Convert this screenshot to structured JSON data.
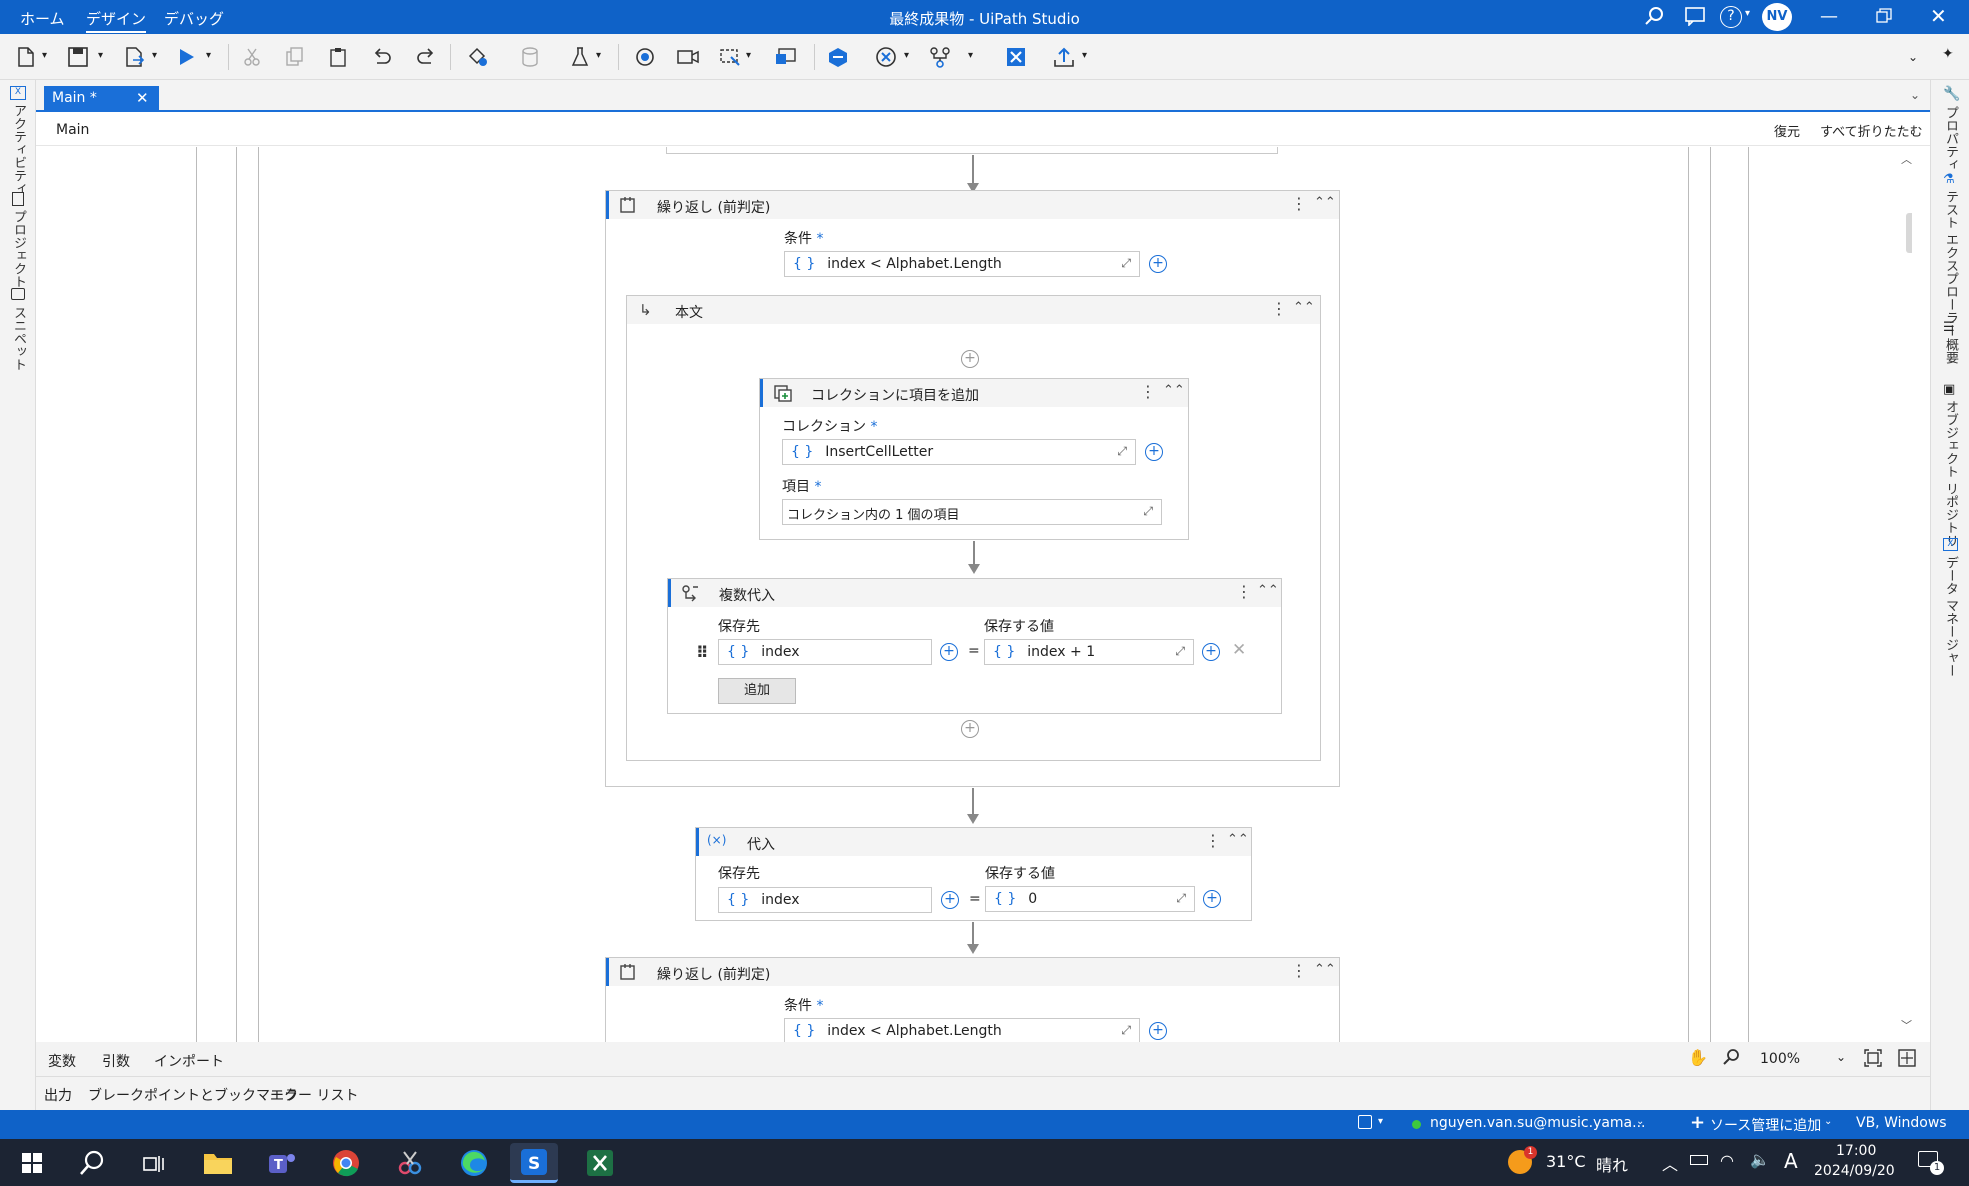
{
  "titlebar": {
    "menu_home": "ホーム",
    "menu_design": "デザイン",
    "menu_debug": "デバッグ",
    "window_title": "最終成果物 - UiPath Studio",
    "avatar_initials": "NV",
    "help_label": "?"
  },
  "tabs": {
    "main": "Main *"
  },
  "breadcrumb": {
    "path": "Main",
    "restore": "復元",
    "collapse_all": "すべて折りたたむ"
  },
  "left_panel": {
    "activities": "アクティビティ",
    "project": "プロジェクト",
    "snippets": "スニペット"
  },
  "right_panel": {
    "properties": "プロパティ",
    "test_explorer": "テスト エクスプローラー",
    "outline": "概要",
    "object_repository": "オブジェクト リポジトリ",
    "data_manager": "データ マネージャー"
  },
  "workflow": {
    "while1": {
      "title": "繰り返し (前判定)",
      "condition_label": "条件",
      "condition_value": "index < Alphabet.Length",
      "body": {
        "title": "本文",
        "add_to_collection": {
          "title": "コレクションに項目を追加",
          "collection_label": "コレクション",
          "collection_value": "InsertCellLetter",
          "item_label": "項目",
          "item_value": "コレクション内の 1 個の項目"
        },
        "multi_assign": {
          "title": "複数代入",
          "to_label": "保存先",
          "value_label": "保存する値",
          "to_value": "index",
          "value_value": "index + 1",
          "add_button": "追加"
        }
      }
    },
    "assign": {
      "title": "代入",
      "to_label": "保存先",
      "value_label": "保存する値",
      "to_value": "index",
      "value_value": "0"
    },
    "while2": {
      "title": "繰り返し (前判定)",
      "condition_label": "条件",
      "condition_value": "index < Alphabet.Length"
    },
    "required_mark": "*",
    "brace_glyph": "{ }",
    "equals": "="
  },
  "bottom_tabs_1": {
    "variables": "変数",
    "arguments": "引数",
    "imports": "インポート",
    "zoom": "100%"
  },
  "bottom_tabs_2": {
    "output": "出力",
    "breakpoints": "ブレークポイントとブックマーク",
    "error_list": "エラー リスト"
  },
  "statusbar": {
    "user": "nguyen.van.su@music.yama...",
    "source_control": "ソース管理に追加",
    "platform": "VB, Windows"
  },
  "taskbar": {
    "temperature": "31°C",
    "weather": "晴れ",
    "time": "17:00",
    "date": "2024/09/20",
    "ime": "A",
    "notification_badge": "1",
    "weather_badge": "1"
  },
  "colors": {
    "accent": "#1a6fd8",
    "titlebar": "#0f62c8",
    "taskbar": "#1c2433"
  }
}
